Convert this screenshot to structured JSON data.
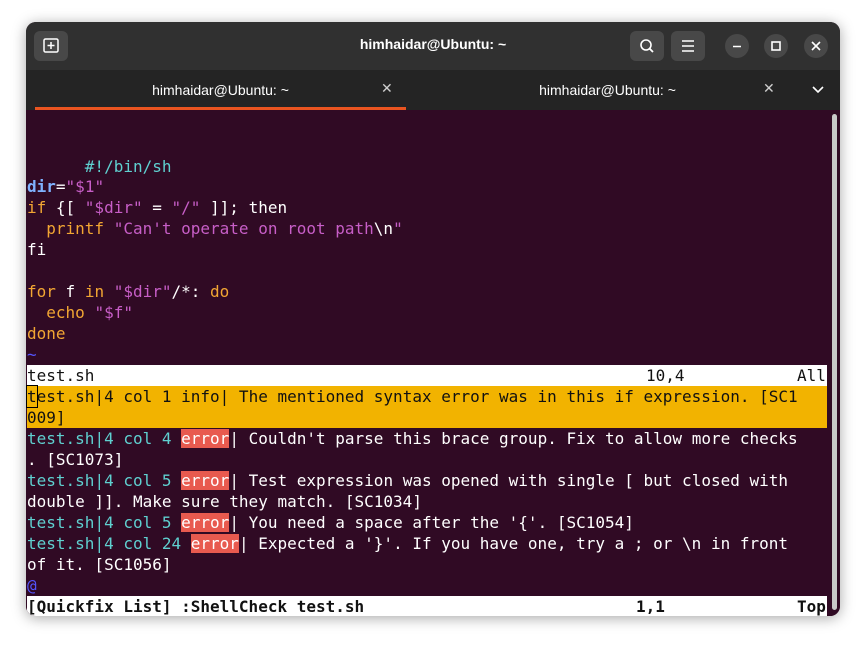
{
  "window": {
    "title": "himhaidar@Ubuntu: ~",
    "icons": [
      "new-tab-icon",
      "search-icon",
      "menu-icon",
      "minimize-icon",
      "maximize-icon",
      "close-icon"
    ]
  },
  "tabs": [
    {
      "label": "himhaidar@Ubuntu: ~",
      "active": true
    },
    {
      "label": "himhaidar@Ubuntu: ~",
      "active": false
    }
  ],
  "editor": {
    "shebang": "#!/bin/sh",
    "l3_var": "dir",
    "l3_eq": "=",
    "l3_val": "\"$1\"",
    "l4_if": "if",
    "l4_a": " {[ ",
    "l4_s1": "\"$dir\"",
    "l4_b": " = ",
    "l4_s2": "\"/\"",
    "l4_c": " ]]; ",
    "l4_then": "then",
    "l5_indent": "  ",
    "l5_printf": "printf",
    "l5_sp": " ",
    "l5_str": "\"Can't operate on root path",
    "l5_nl": "\\n",
    "l5_q": "\"",
    "l6_fi": "fi",
    "l8_for": "for",
    "l8_f": " f ",
    "l8_in": "in",
    "l8_sp": " ",
    "l8_str": "\"$dir\"",
    "l8_glob": "/*: ",
    "l8_do": "do",
    "l9_indent": "  ",
    "l9_echo": "echo",
    "l9_sp": " ",
    "l9_str": "\"$f\"",
    "l10_done": "done",
    "tilde": "~"
  },
  "status_top": {
    "file": "test.sh",
    "position": "10,4",
    "scroll": "All"
  },
  "quickfix": {
    "item1_line1_cursor": "t",
    "item1_line1_rest": "est.sh|4 col 1 info| The mentioned syntax error was in this if expression. [SC1",
    "item1_line2": "009]",
    "items": [
      {
        "file": "test.sh",
        "loc": "|4 col 4 ",
        "sev": "error",
        "msg1": "| Couldn't parse this brace group. Fix to allow more checks",
        "msg2": ". [SC1073]"
      },
      {
        "file": "test.sh",
        "loc": "|4 col 5 ",
        "sev": "error",
        "msg1": "| Test expression was opened with single [ but closed with",
        "msg2": "double ]]. Make sure they match. [SC1034]"
      },
      {
        "file": "test.sh",
        "loc": "|4 col 5 ",
        "sev": "error",
        "msg1": "| You need a space after the '{'. [SC1054]",
        "msg2": ""
      },
      {
        "file": "test.sh",
        "loc": "|4 col 24 ",
        "sev": "error",
        "msg1": "| Expected a '}'. If you have one, try a ; or \\n in front",
        "msg2": "of it. [SC1056]"
      }
    ],
    "at": "@"
  },
  "status_bottom": {
    "name": "[Quickfix List] :ShellCheck test.sh",
    "position": "1,1",
    "scroll": "Top"
  }
}
